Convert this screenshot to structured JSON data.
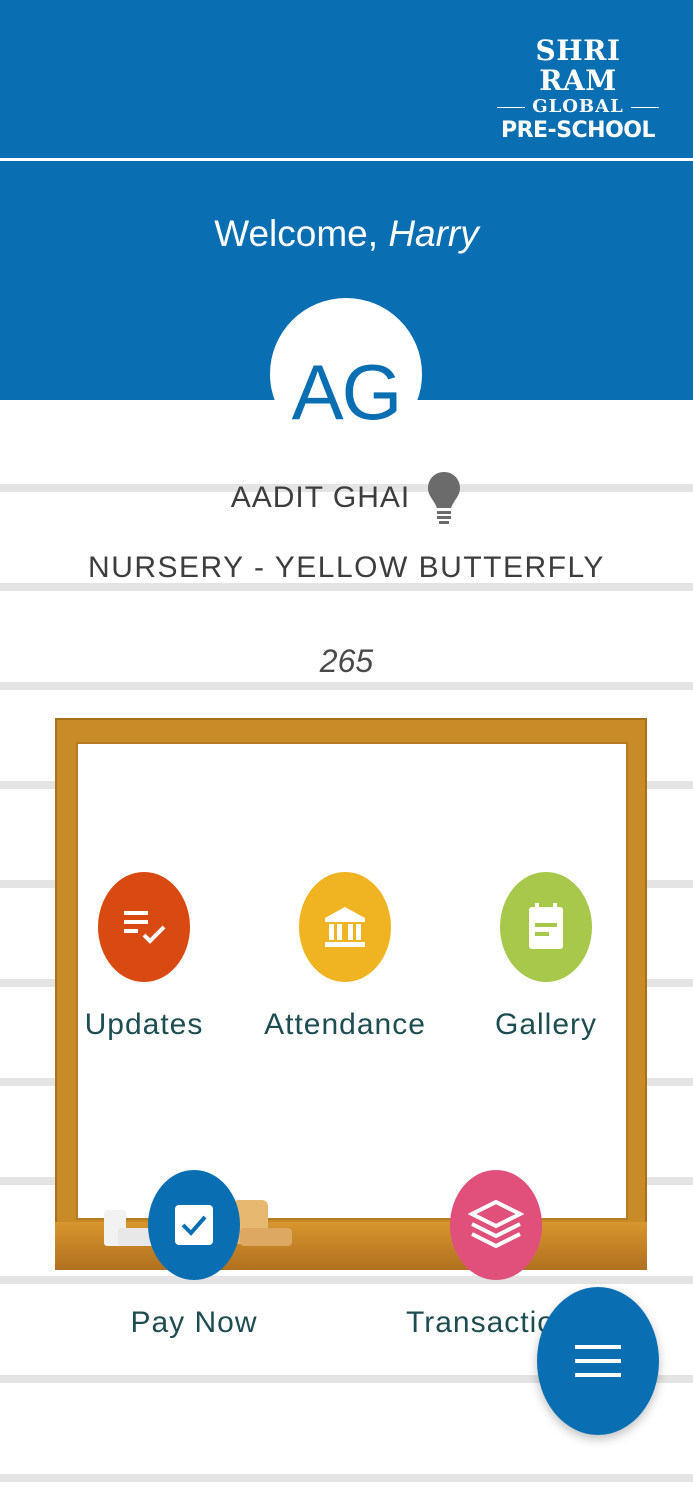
{
  "brand": {
    "line1": "SHRI RAM",
    "line2": "GLOBAL",
    "line3": "PRE-SCHOOL",
    "color": "#0a6fb2"
  },
  "welcome": {
    "prefix": "Welcome, ",
    "name": "Harry"
  },
  "student": {
    "initials": "AG",
    "name": "AADIT GHAI",
    "class": "NURSERY - YELLOW BUTTERFLY",
    "number": "265"
  },
  "menu": [
    {
      "label": "Updates",
      "icon": "updates-icon",
      "color": "#d84a12"
    },
    {
      "label": "Attendance",
      "icon": "bank-icon",
      "color": "#f0b422"
    },
    {
      "label": "Gallery",
      "icon": "note-icon",
      "color": "#a8c84c"
    },
    {
      "label": "Pay Now",
      "icon": "checkbox-icon",
      "color": "#0a6fb2"
    },
    {
      "label": "Transactio",
      "icon": "layers-icon",
      "color": "#e0507a"
    }
  ],
  "fab": {
    "icon": "hamburger-menu-icon"
  }
}
